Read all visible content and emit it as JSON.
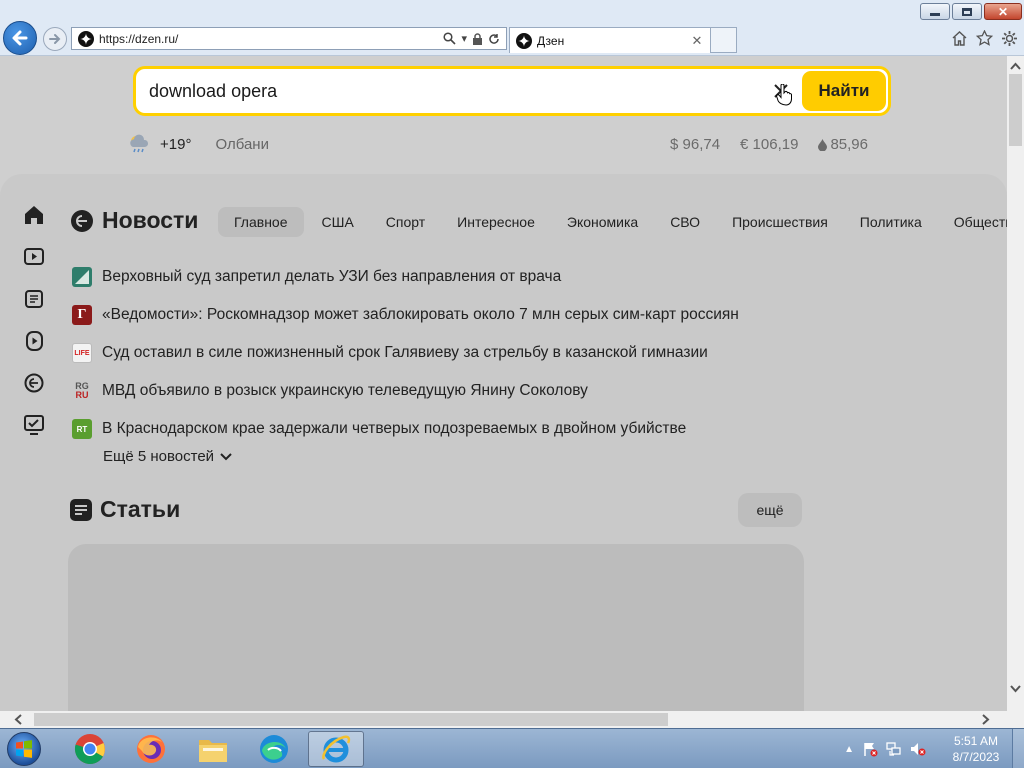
{
  "window": {
    "address_url": "https://dzen.ru/",
    "tab_title": "Дзен"
  },
  "search": {
    "value": "download opera",
    "button_label": "Найти"
  },
  "weather": {
    "temperature": "+19°",
    "city": "Олбани"
  },
  "rates": {
    "usd": "$ 96,74",
    "eur": "€ 106,19",
    "oil": "85,96"
  },
  "news": {
    "title": "Новости",
    "tabs": [
      "Главное",
      "США",
      "Спорт",
      "Интересное",
      "Экономика",
      "СВО",
      "Происшествия",
      "Политика",
      "Общество"
    ],
    "active_tab": "Главное",
    "items": [
      {
        "source": "source-icon-1",
        "text": "Верховный суд запретил делать УЗИ без направления от врача"
      },
      {
        "source": "vedomosti",
        "text": "«Ведомости»: Роскомнадзор может заблокировать около 7 млн серых сим-карт россиян"
      },
      {
        "source": "life",
        "text": "Суд оставил в силе пожизненный срок Галявиеву за стрельбу в казанской гимназии"
      },
      {
        "source": "rg-ru",
        "text": "МВД объявило в розыск украинскую телеведущую Янину Соколову"
      },
      {
        "source": "rt",
        "text": "В Краснодарском крае задержали четверых подозреваемых в двойном убийстве"
      }
    ],
    "source_labels": {
      "vedomosti": "Г",
      "life": "LIFE",
      "rg": "RG",
      "ru": "RU",
      "rt": "RT"
    },
    "more_label": "Ещё 5 новостей"
  },
  "articles": {
    "title": "Статьи",
    "more_label": "ещё"
  },
  "taskbar": {
    "apps": [
      "chrome-icon",
      "firefox-icon",
      "file-explorer-icon",
      "edge-icon",
      "internet-explorer-icon"
    ],
    "time": "5:51 AM",
    "date": "8/7/2023"
  },
  "colors": {
    "search_accent": "#ffd000",
    "search_button": "#ffcc00",
    "overlay_bg": "#cfcfcf"
  }
}
